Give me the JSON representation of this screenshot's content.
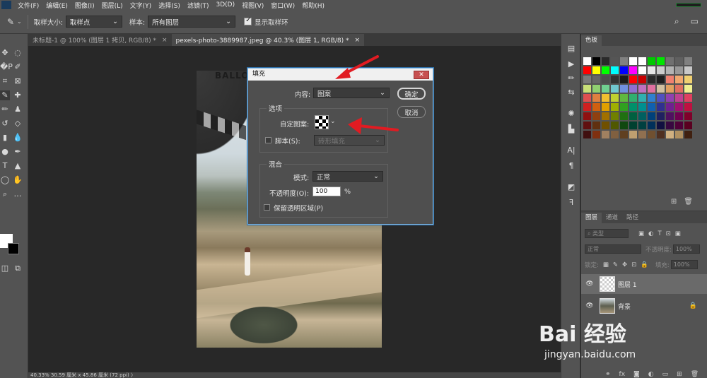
{
  "menubar": {
    "items": [
      "文件(F)",
      "编辑(E)",
      "图像(I)",
      "图层(L)",
      "文字(Y)",
      "选择(S)",
      "滤镜(T)",
      "3D(D)",
      "视图(V)",
      "窗口(W)",
      "帮助(H)"
    ]
  },
  "options_bar": {
    "sample_size_label": "取样大小:",
    "sample_size_value": "取样点",
    "sample_label": "样本:",
    "sample_value": "所有图层",
    "show_ring_label": "显示取样环"
  },
  "tabs": [
    {
      "label": "未标题-1 @ 100% (图层 1 拷贝, RGB/8) *",
      "close": "×",
      "active": false
    },
    {
      "label": "pexels-photo-3889987.jpeg @ 40.3% (图层 1, RGB/8) *",
      "close": "×",
      "active": true
    }
  ],
  "status_bar": {
    "text": "40.33%     30.59 厘米 x 45.86 厘米 (72 ppi)    〉"
  },
  "photo": {
    "sign_text": "BALLO"
  },
  "fill_dialog": {
    "title": "填充",
    "close_label": "✕",
    "content_label": "内容:",
    "content_value": "图案",
    "ok_label": "确定",
    "cancel_label": "取消",
    "options_group": "选项",
    "custom_pattern_label": "自定图案:",
    "script_label": "脚本(S):",
    "script_value": "砖形填充",
    "blend_group": "混合",
    "mode_label": "模式:",
    "mode_value": "正常",
    "opacity_label": "不透明度(O):",
    "opacity_value": "100",
    "opacity_unit": "%",
    "preserve_label": "保留透明区域(P)"
  },
  "swatches_panel": {
    "tab": "色板",
    "colors": [
      "#ffffff",
      "#000000",
      "#2a2a2a",
      "#555555",
      "#808080",
      "#ffffff",
      "#ffffff",
      "#00c800",
      "#00e600",
      "#707070",
      "#606060",
      "#808080",
      "#ff0000",
      "#ffff00",
      "#00ff00",
      "#00ffff",
      "#0000ff",
      "#ff00ff",
      "#ffffff",
      "#e6e6e6",
      "#cccccc",
      "#b3b3b3",
      "#999999",
      "#c8c8c8",
      "#7a7a7a",
      "#666666",
      "#4d4d4d",
      "#333333",
      "#1a1a1a",
      "#ff0000",
      "#c80000",
      "#2a2a2a",
      "#1e1e1e",
      "#f08070",
      "#f0a870",
      "#f0d070",
      "#c8e078",
      "#90d070",
      "#70d090",
      "#70c8d0",
      "#7090e0",
      "#9070d0",
      "#c070c0",
      "#e070a0",
      "#d0c0a0",
      "#e0a060",
      "#e07060",
      "#f0f090",
      "#e05050",
      "#e08040",
      "#f0c030",
      "#c0d030",
      "#60b840",
      "#30b070",
      "#30b0b0",
      "#3080d0",
      "#5050c0",
      "#9040b0",
      "#c04090",
      "#e04060",
      "#d02020",
      "#d06010",
      "#e0a000",
      "#a0b000",
      "#30a020",
      "#00906a",
      "#009090",
      "#1060b0",
      "#303090",
      "#702090",
      "#a01070",
      "#c01040",
      "#901010",
      "#904010",
      "#a07000",
      "#708000",
      "#207010",
      "#006040",
      "#006060",
      "#00407a",
      "#202060",
      "#501060",
      "#700050",
      "#80002a",
      "#601010",
      "#603010",
      "#705000",
      "#505800",
      "#104810",
      "#004030",
      "#004040",
      "#00305a",
      "#101040",
      "#380840",
      "#500038",
      "#5a0020",
      "#401010",
      "#803010",
      "#a08060",
      "#806040",
      "#604020",
      "#c0a070",
      "#907050",
      "#705030",
      "#503020",
      "#d0b080",
      "#b09060",
      "#402010"
    ],
    "icons": [
      "new-swatch-icon",
      "trash-icon"
    ]
  },
  "layers_panel": {
    "tabs": [
      "图层",
      "通道",
      "路径"
    ],
    "kind_filter": "类型",
    "blend_mode": "正常",
    "opacity_label": "不透明度:",
    "opacity_value": "100%",
    "lock_label": "锁定:",
    "fill_label": "填充:",
    "fill_value": "100%",
    "layers": [
      {
        "name": "图层 1",
        "selected": true,
        "locked": false
      },
      {
        "name": "背景",
        "selected": false,
        "locked": true
      }
    ],
    "bottom_icons": [
      "link-icon",
      "fx-icon",
      "mask-icon",
      "adjustment-icon",
      "group-icon",
      "new-layer-icon",
      "trash-icon"
    ]
  },
  "watermark": {
    "main": "Bai 经验",
    "sub": "jingyan.baidu.com"
  },
  "colors": {
    "accent_red": "#e11b22",
    "dialog_border": "#2d6fa8"
  }
}
